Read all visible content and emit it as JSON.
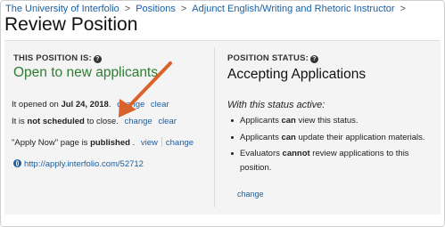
{
  "breadcrumb": {
    "items": [
      "The University of Interfolio",
      "Positions",
      "Adjunct English/Writing and Rhetoric Instructor"
    ],
    "separator": ">"
  },
  "page_title": "Review Position",
  "left": {
    "heading": "THIS POSITION IS:",
    "status": "Open to new applicants",
    "opened_prefix": "It opened on ",
    "opened_date": "Jul 24, 2018",
    "opened_suffix": ".",
    "opened_change": "change",
    "opened_clear": "clear",
    "close_prefix": "It is ",
    "close_bold": "not scheduled",
    "close_suffix": " to close.",
    "close_change": "change",
    "close_clear": "clear",
    "apply_prefix": "\"Apply Now\" page is ",
    "apply_bold": "published",
    "apply_suffix": " .",
    "apply_view": "view",
    "apply_change": "change",
    "url": "http://apply.interfolio.com/52712"
  },
  "right": {
    "heading": "POSITION STATUS:",
    "status": "Accepting Applications",
    "with_status": "With this status active:",
    "bullet1_a": "Applicants ",
    "bullet1_b": "can",
    "bullet1_c": " view this status.",
    "bullet2_a": "Applicants ",
    "bullet2_b": "can",
    "bullet2_c": " update their application materials.",
    "bullet3_a": "Evaluators ",
    "bullet3_b": "cannot",
    "bullet3_c": " review applications to this position.",
    "change": "change"
  },
  "colors": {
    "link": "#1a5fa3",
    "open_status": "#2e7d32",
    "annotation_arrow": "#d9632b",
    "panel_bg": "#f4f4f4"
  },
  "icons": [
    "help-icon",
    "globe-icon",
    "annotation-arrow"
  ]
}
